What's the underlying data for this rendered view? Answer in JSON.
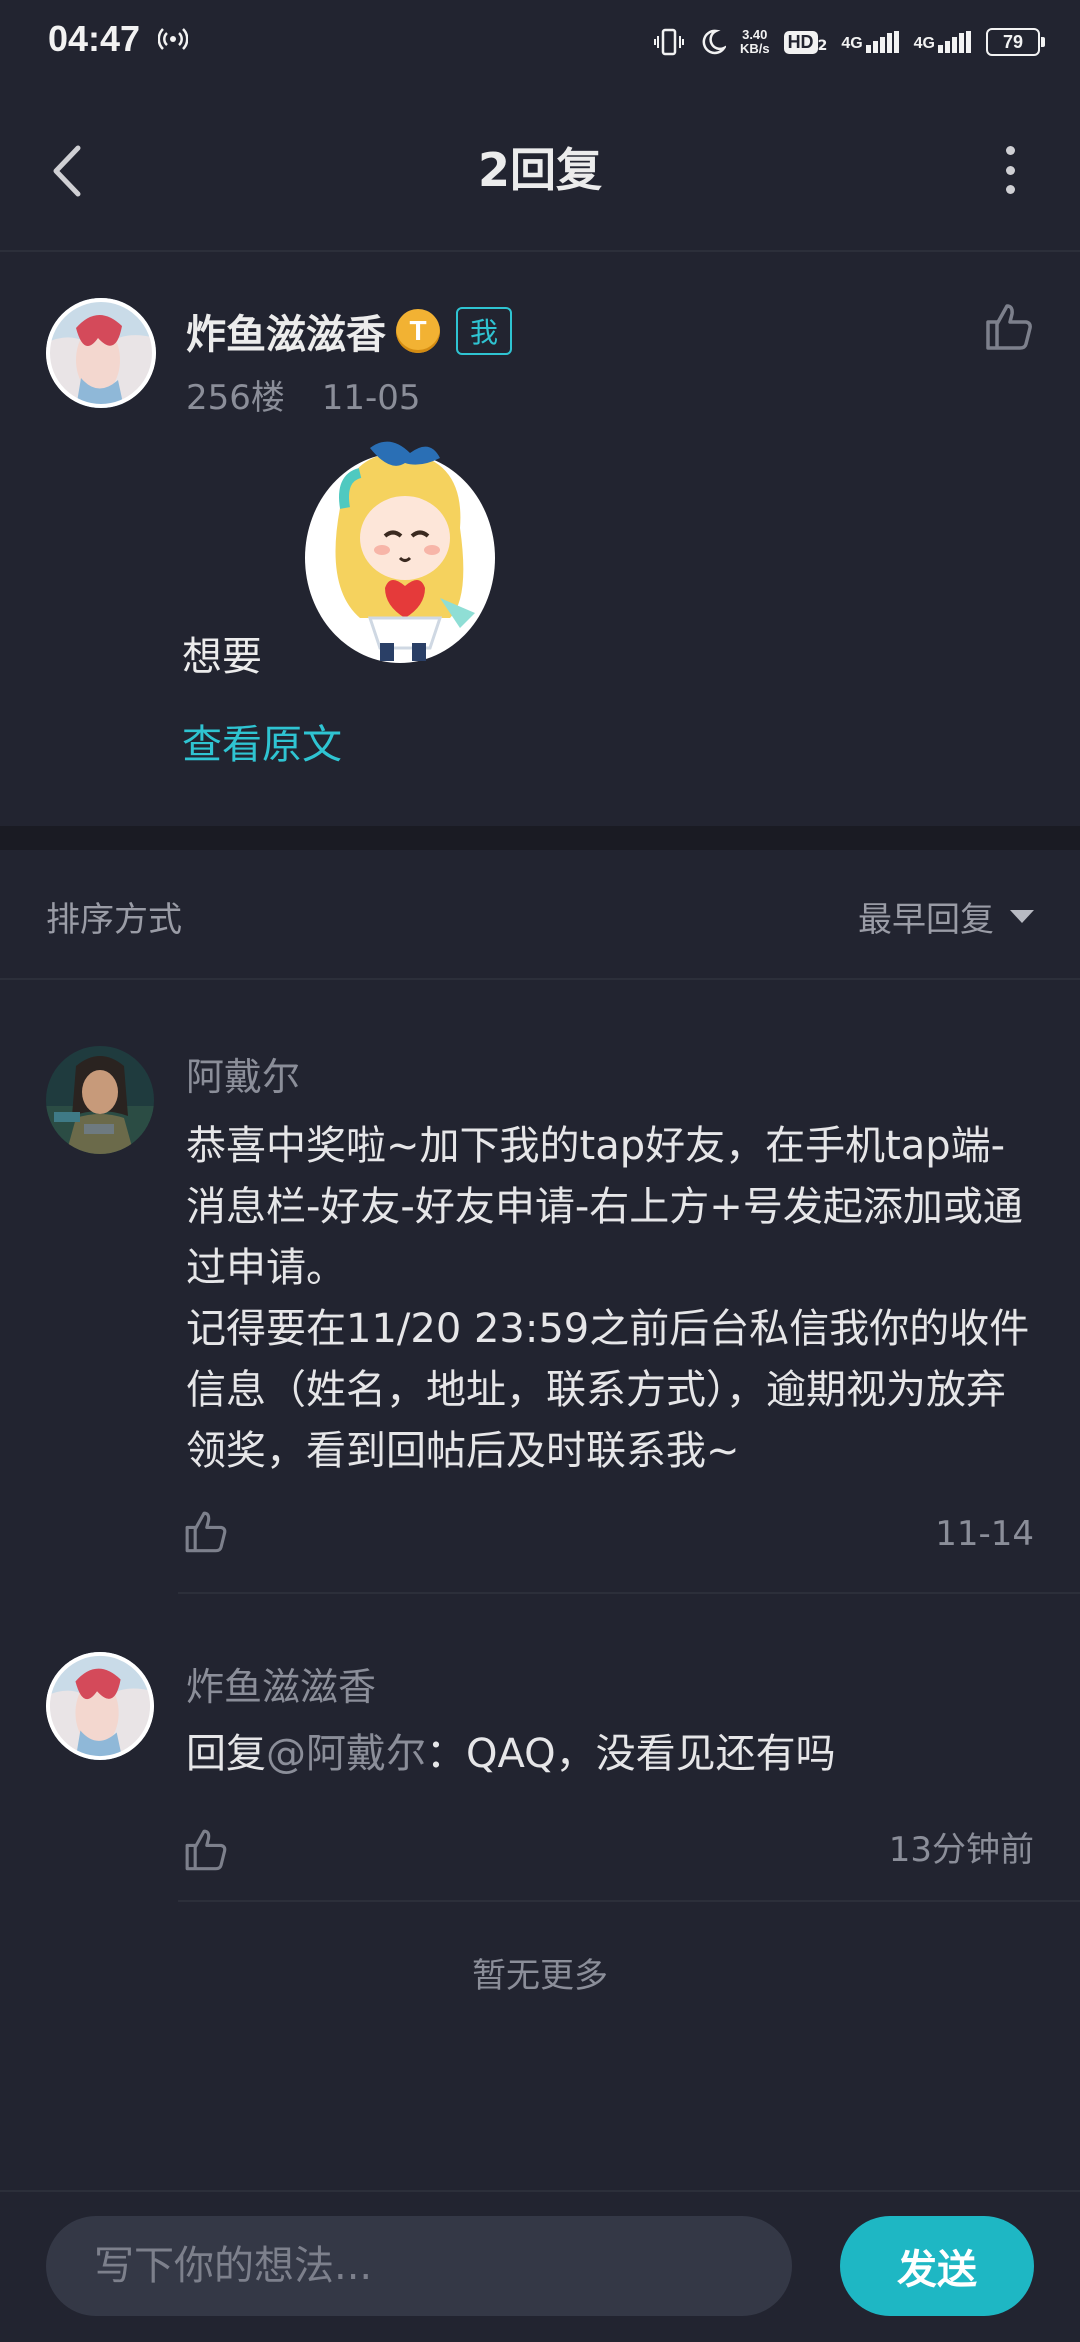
{
  "status_bar": {
    "time": "04:47",
    "net_speed_value": "3.40",
    "net_speed_unit": "KB/s",
    "hd_label": "HD",
    "hd_sub": "2",
    "net1": "4G",
    "net2": "4G",
    "battery": "79"
  },
  "header": {
    "title": "2回复"
  },
  "post": {
    "author": "炸鱼滋滋香",
    "badge_t": "T",
    "badge_me": "我",
    "floor": "256楼",
    "date": "11-05",
    "text": "想要",
    "view_original": "查看原文"
  },
  "sort": {
    "label": "排序方式",
    "value": "最早回复"
  },
  "replies": [
    {
      "author": "阿戴尔",
      "lines": [
        "恭喜中奖啦~加下我的tap好友，在手机tap端-消息栏-好友-好友申请-右上方+号发起添加或通过申请。",
        "记得要在11/20 23:59之前后台私信我你的收件信息（姓名，地址，联系方式），逾期视为放弃领奖，看到回帖后及时联系我~"
      ],
      "time": "11-14"
    },
    {
      "author": "炸鱼滋滋香",
      "reply_prefix": "回复",
      "mention": "@阿戴尔",
      "reply_text": "：QAQ，没看见还有吗",
      "time": "13分钟前"
    }
  ],
  "no_more": "暂无更多",
  "composer": {
    "placeholder": "写下你的想法...",
    "send_label": "发送"
  },
  "colors": {
    "background": "#222430",
    "accent": "#2fc4d2",
    "send_button": "#1eb7c4"
  }
}
